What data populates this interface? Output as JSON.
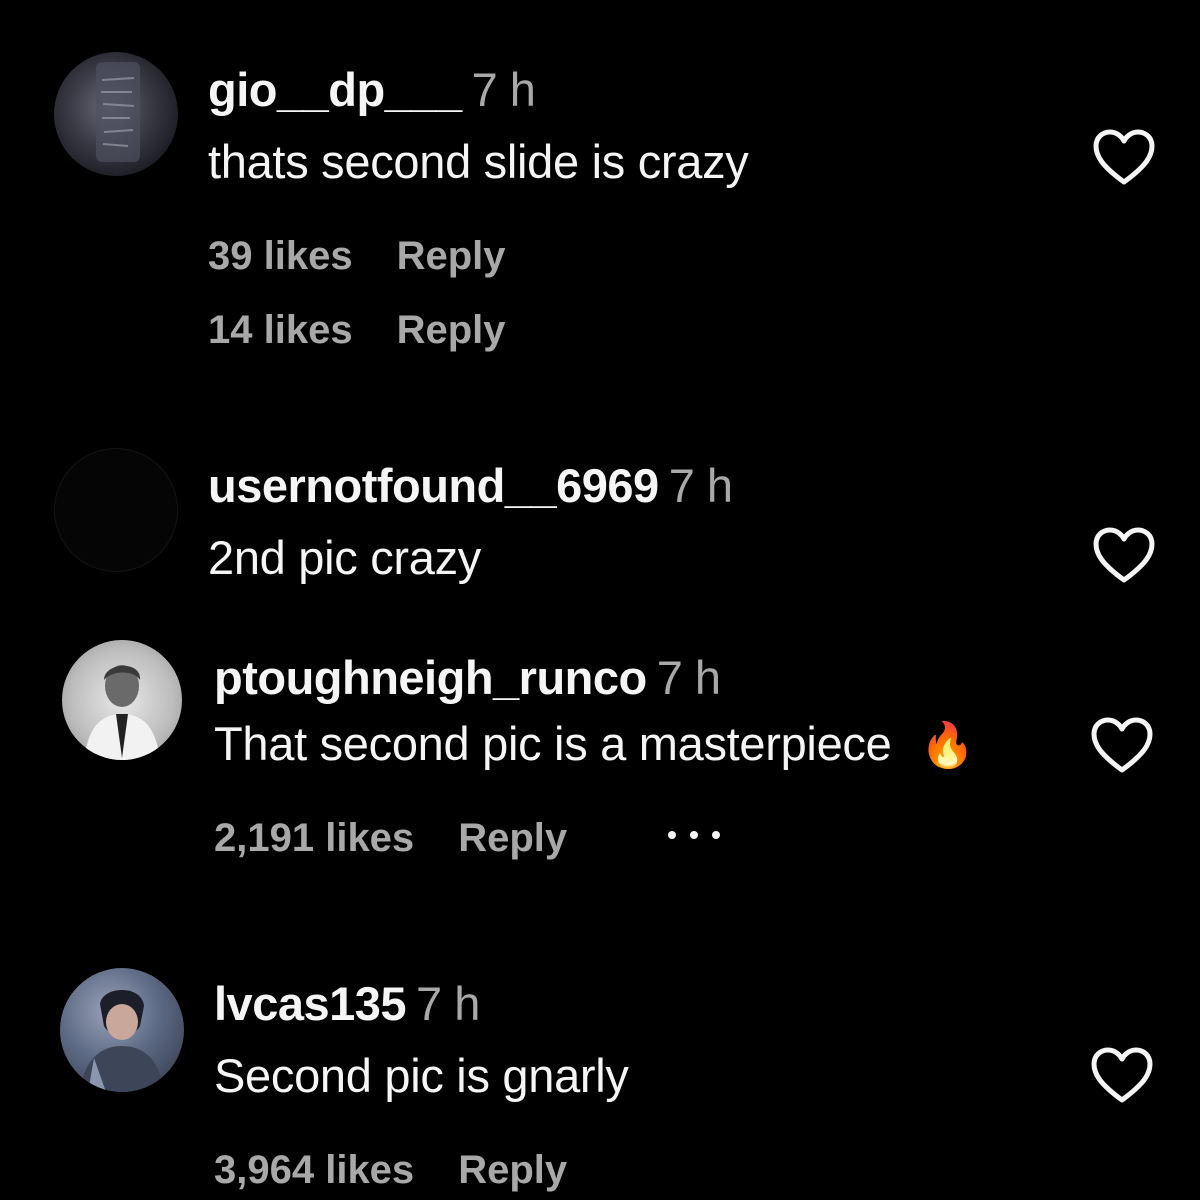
{
  "comments": [
    {
      "username": "gio__dp___",
      "time": "7 h",
      "text": "thats second slide is crazy",
      "likes": "39 likes",
      "reply": "Reply",
      "likes_2": "14 likes",
      "reply_2": "Reply"
    },
    {
      "username": "usernotfound__6969",
      "time": "7 h",
      "text": "2nd pic crazy"
    },
    {
      "username": "ptoughneigh_runco",
      "time": "7 h",
      "text": "That second pic is a masterpiece",
      "emoji": "🔥",
      "likes": "2,191 likes",
      "reply": "Reply"
    },
    {
      "username": "lvcas135",
      "time": "7 h",
      "text": "Second pic is gnarly",
      "likes": "3,964 likes",
      "reply": "Reply"
    }
  ],
  "icons": {
    "like": "heart-outline-icon",
    "more": "more-dots-icon",
    "fire": "fire-emoji-icon"
  },
  "colors": {
    "background": "#000000",
    "primary_text": "#f5f5f5",
    "secondary_text": "#a8a8a8",
    "fire": "#ff7a1a"
  }
}
